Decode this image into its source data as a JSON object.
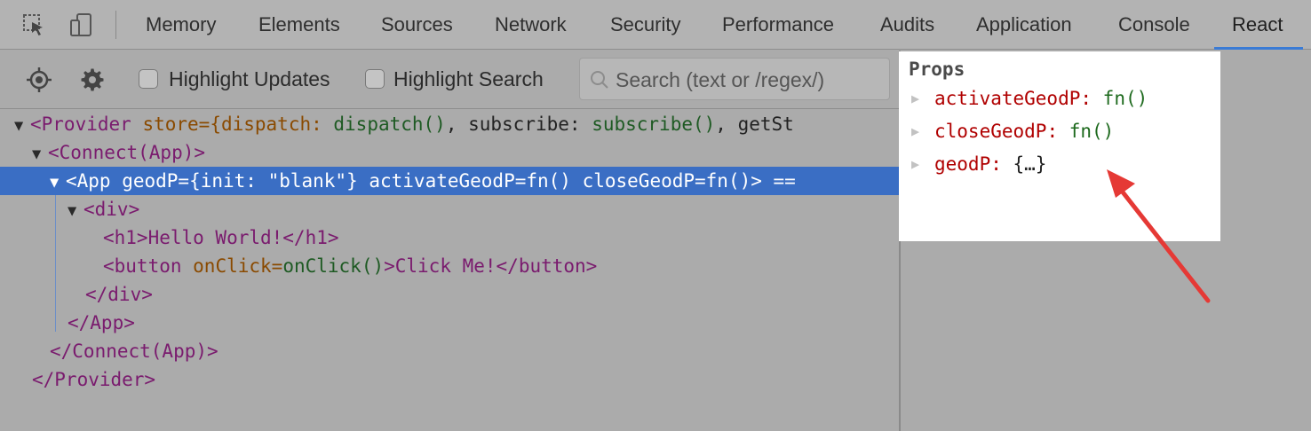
{
  "tabs": [
    "Memory",
    "Elements",
    "Sources",
    "Network",
    "Security",
    "Performance",
    "Audits",
    "Application",
    "Console",
    "React"
  ],
  "active_tab": "React",
  "toolbar": {
    "highlight_updates": "Highlight Updates",
    "highlight_search": "Highlight Search",
    "search_placeholder": "Search (text or /regex/)"
  },
  "tree": {
    "provider_open": "<Provider",
    "provider_attr": "store=",
    "provider_props_1": "{dispatch: ",
    "provider_props_2": "dispatch()",
    "provider_props_3": ", subscribe: ",
    "provider_props_4": "subscribe()",
    "provider_props_5": ", getSt",
    "connect_open": "<Connect(App)>",
    "app_row": "<App geodP={init: \"blank\"} activateGeodP=fn() closeGeodP=fn()> ==",
    "div_open": "<div>",
    "h1_line": "<h1>Hello World!</h1>",
    "button_open": "<button ",
    "button_attr": "onClick=",
    "button_val": "onClick()",
    "button_rest": ">Click Me!</button>",
    "div_close": "</div>",
    "app_close": "</App>",
    "connect_close": "</Connect(App)>",
    "provider_close": "</Provider>"
  },
  "props": {
    "title": "Props",
    "items": [
      {
        "name": "activateGeodP",
        "value": "fn()"
      },
      {
        "name": "closeGeodP",
        "value": "fn()"
      },
      {
        "name": "geodP",
        "value": "{…}"
      }
    ]
  },
  "colors": {
    "annotation_arrow": "#e53935",
    "selection": "#3a6ec4",
    "active_tab_underline": "#3a7bd5"
  }
}
